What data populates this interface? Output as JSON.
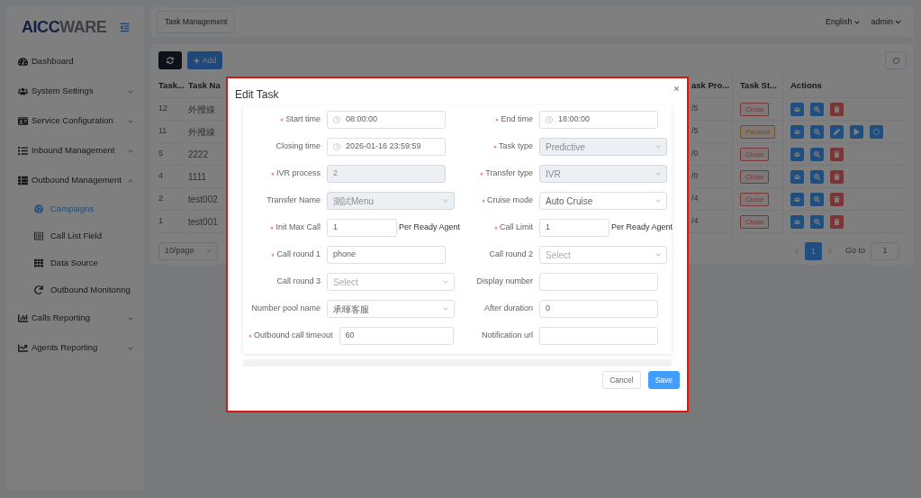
{
  "sidebar": {
    "logo": [
      "AICC",
      "WARE"
    ],
    "items": [
      {
        "label": "Dashboard",
        "selected": false
      },
      {
        "label": "System Settings",
        "selected": false,
        "expanded": false
      },
      {
        "label": "Service Configuration",
        "selected": false,
        "expanded": false
      },
      {
        "label": "Inbound Management",
        "selected": false,
        "expanded": false
      },
      {
        "label": "Outbound Management",
        "selected": false,
        "expanded": true,
        "children": [
          {
            "label": "Campaigns",
            "selected": true
          },
          {
            "label": "Call List Field",
            "selected": false
          },
          {
            "label": "Data Source",
            "selected": false
          },
          {
            "label": "Outbound Monitoring",
            "selected": false
          }
        ]
      },
      {
        "label": "Calls Reporting",
        "selected": false,
        "expanded": false
      },
      {
        "label": "Agents Reporting",
        "selected": false,
        "expanded": false
      }
    ]
  },
  "header": {
    "tab": "Task Management",
    "language": "English",
    "user": "admin"
  },
  "toolbar": {
    "add": "Add"
  },
  "table": {
    "columns": [
      "Task...",
      "Task Na",
      "ask Pro...",
      "Task St...",
      "Actions"
    ],
    "rows": [
      {
        "id": "12",
        "name": "外撥線",
        "progress": "/5",
        "status": {
          "label": "Close",
          "color": "#7b3636"
        },
        "actions": [
          {
            "kind": "members"
          },
          {
            "kind": "view"
          },
          {
            "kind": "delete"
          }
        ]
      },
      {
        "id": "11",
        "name": "外撥線",
        "progress": "/5",
        "status": {
          "label": "Paused",
          "color": "#73511e"
        },
        "actions": [
          {
            "kind": "members"
          },
          {
            "kind": "view"
          },
          {
            "kind": "edit"
          },
          {
            "kind": "start"
          },
          {
            "kind": "stop"
          }
        ]
      },
      {
        "id": "5",
        "name": "2222",
        "progress": "/0",
        "status": {
          "label": "Close",
          "color": "#7b3636"
        },
        "actions": [
          {
            "kind": "members"
          },
          {
            "kind": "view"
          },
          {
            "kind": "delete"
          }
        ]
      },
      {
        "id": "4",
        "name": "1111",
        "progress": "/0",
        "status": {
          "label": "Close",
          "color": "#7b3636"
        },
        "actions": [
          {
            "kind": "members"
          },
          {
            "kind": "view"
          },
          {
            "kind": "delete"
          }
        ]
      },
      {
        "id": "2",
        "name": "test002",
        "progress": "/4",
        "status": {
          "label": "Close",
          "color": "#7b3636"
        },
        "actions": [
          {
            "kind": "members"
          },
          {
            "kind": "view"
          },
          {
            "kind": "delete"
          }
        ]
      },
      {
        "id": "1",
        "name": "test001",
        "progress": "/4",
        "status": {
          "label": "Close",
          "color": "#7b3636"
        },
        "actions": [
          {
            "kind": "members"
          },
          {
            "kind": "view"
          },
          {
            "kind": "delete"
          }
        ]
      }
    ]
  },
  "pagination": {
    "page_size": "10/page",
    "pages": [
      {
        "label": "1",
        "selected": true
      }
    ],
    "goto_label": "Go to",
    "goto_value": "1"
  },
  "dialog": {
    "title": "Edit Task",
    "fields": [
      {
        "label": "Start time",
        "required": true,
        "kind": "time",
        "value": "08:00:00",
        "disabled": false
      },
      {
        "label": "End time",
        "required": true,
        "kind": "time",
        "value": "18:00:00",
        "disabled": false
      },
      {
        "label": "Closing time",
        "required": false,
        "kind": "time",
        "value": "2026-01-16 23:59:59",
        "disabled": false
      },
      {
        "label": "Task type",
        "required": true,
        "kind": "select",
        "value": "Predictive",
        "disabled": true
      },
      {
        "label": "IVR process",
        "required": true,
        "kind": "input",
        "value": "2",
        "disabled": true
      },
      {
        "label": "Transfer type",
        "required": true,
        "kind": "select",
        "value": "IVR",
        "disabled": true
      },
      {
        "label": "Transfer Name",
        "required": false,
        "kind": "select",
        "value": "測試Menu",
        "disabled": true
      },
      {
        "label": "Cruise mode",
        "required": true,
        "kind": "select",
        "value": "Auto Cruise",
        "disabled": false
      },
      {
        "label": "Init Max Call",
        "required": true,
        "kind": "input_suffix",
        "value": "1",
        "suffix": "Per Ready Agent",
        "disabled": false
      },
      {
        "label": "Call Limit",
        "required": true,
        "kind": "input_suffix",
        "value": "1",
        "suffix": "Per Ready Agent",
        "disabled": false
      },
      {
        "label": "Call round 1",
        "required": true,
        "kind": "input",
        "value": "phone",
        "disabled": false
      },
      {
        "label": "Call round 2",
        "required": false,
        "kind": "select",
        "placeholder": "Select",
        "disabled": false
      },
      {
        "label": "Call round 3",
        "required": false,
        "kind": "select",
        "placeholder": "Select",
        "disabled": false
      },
      {
        "label": "Display number",
        "required": false,
        "kind": "input",
        "disabled": false
      },
      {
        "label": "Number pool name",
        "required": false,
        "kind": "select",
        "value": "承暉客服",
        "disabled": false
      },
      {
        "label": "After duration",
        "required": false,
        "kind": "input",
        "value": "0",
        "disabled": false
      },
      {
        "label": "Outbound call timeout",
        "required": true,
        "kind": "input",
        "value": "60",
        "disabled": false
      },
      {
        "label": "Notification url",
        "required": false,
        "kind": "input",
        "disabled": false
      }
    ],
    "buttons": [
      {
        "label": "Cancel",
        "kind": "secondary"
      },
      {
        "label": "Save",
        "kind": "primary"
      }
    ]
  }
}
